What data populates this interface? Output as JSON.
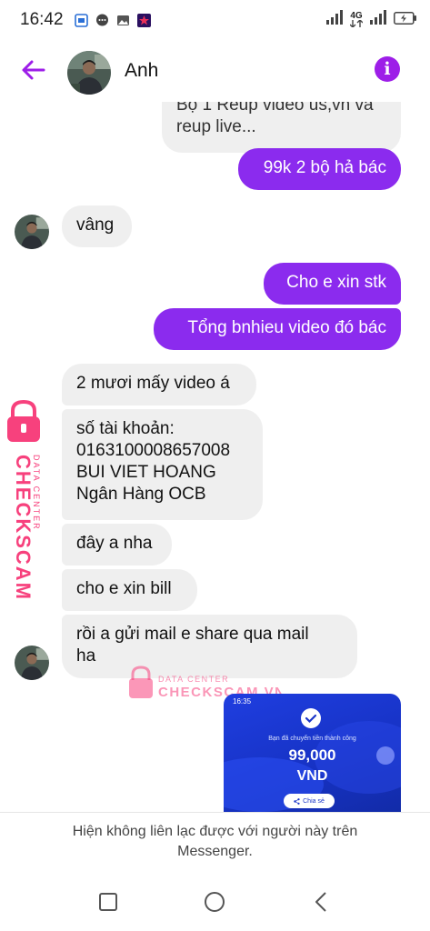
{
  "status_bar": {
    "time": "16:42",
    "network": "4G"
  },
  "header": {
    "contact_name": "Anh"
  },
  "messages": [
    {
      "id": "m1",
      "direction": "in",
      "text": "Bộ 1 Reup video us,vn và reup live..."
    },
    {
      "id": "m2",
      "direction": "out",
      "text": "99k 2 bộ hả bác"
    },
    {
      "id": "m3",
      "direction": "in",
      "text": "vâng"
    },
    {
      "id": "m4",
      "direction": "out",
      "text": "Cho e xin stk"
    },
    {
      "id": "m5",
      "direction": "out",
      "text": "Tổng bnhieu video đó bác"
    },
    {
      "id": "m6",
      "direction": "in",
      "text": "2 mươi mấy video á"
    },
    {
      "id": "m7",
      "direction": "in",
      "lines": [
        "số tài khoản:",
        "0163100008657008",
        "BUI VIET HOANG",
        "Ngân Hàng OCB"
      ]
    },
    {
      "id": "m8",
      "direction": "in",
      "text": "đây a nha"
    },
    {
      "id": "m9",
      "direction": "in",
      "text": "cho e xin bill"
    },
    {
      "id": "m10",
      "direction": "in",
      "lines": [
        "rồi a gửi mail e share qua mail",
        "ha"
      ]
    }
  ],
  "receipt_image": {
    "time": "16:35",
    "subtitle": "Bạn đã chuyển tiền thành công",
    "amount": "99,000",
    "currency": "VND",
    "share_label": "Chia sẻ"
  },
  "watermark": {
    "line1": "DATA CENTER",
    "line2": "CHECKSCAM.VN",
    "color": "#f7417d"
  },
  "footer": {
    "notice": "Hiện không liên lạc được với người này trên Messenger."
  },
  "colors": {
    "accent": "#9d1ee8",
    "outgoing_bubble": "#8b2bee",
    "incoming_bubble": "#efefef"
  }
}
